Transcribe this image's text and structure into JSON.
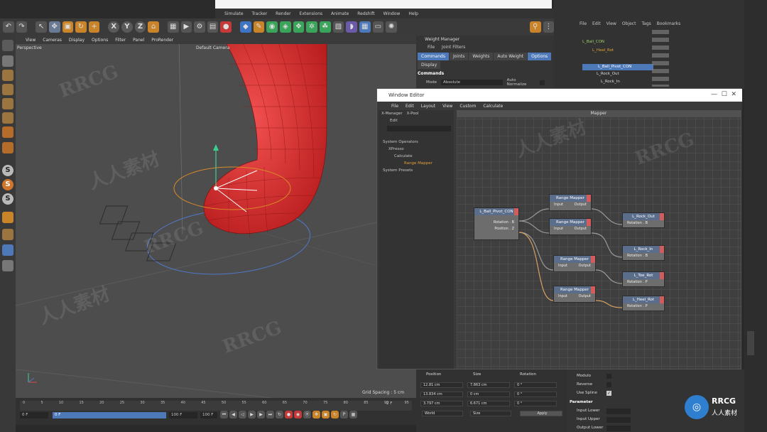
{
  "app_menu": [
    "Simulate",
    "Tracker",
    "Render",
    "Extensions",
    "Animate",
    "Redshift",
    "Window",
    "Help"
  ],
  "viewport": {
    "menu": [
      "View",
      "Cameras",
      "Display",
      "Options",
      "Filter",
      "Panel",
      "ProRender"
    ],
    "name": "Perspective",
    "camera": "Default Camera",
    "grid_spacing": "Grid Spacing : 5 cm"
  },
  "weight_manager": {
    "title": "Weight Manager",
    "menu": [
      "File",
      "Joint Filters"
    ],
    "tabs": [
      "Commands",
      "Joints",
      "Weights",
      "Auto Weight",
      "Options"
    ],
    "tab2": "Display",
    "section": "Commands",
    "mode_label": "Mode",
    "mode_value": "Absolute",
    "auto_normalize": "Auto Normalize"
  },
  "object_manager": {
    "menu": [
      "File",
      "Edit",
      "View",
      "Object",
      "Tags",
      "Bookmarks"
    ],
    "items": [
      "L_Ball_CON",
      "L_Heel_Rot",
      "L_Ball_Pivot_CON",
      "L_Rock_Out",
      "L_Rock_In"
    ]
  },
  "xpresso": {
    "title": "Window Editor",
    "menu": [
      "File",
      "Edit",
      "Layout",
      "View",
      "Custom",
      "Calculate"
    ],
    "tabs": [
      "X-Manager",
      "X-Pool"
    ],
    "field": "Edit",
    "tree": [
      "System Operators",
      "XPresso",
      "Calculate",
      "Range Mapper",
      "System Presets"
    ],
    "graph_title": "Mapper",
    "nodes": {
      "source": {
        "title": "L_Ball_Pivot_CON",
        "ports": [
          "Rotation . B",
          "Position . Z"
        ]
      },
      "rm1": {
        "title": "Range Mapper",
        "in": "Input",
        "out": "Output"
      },
      "rm2": {
        "title": "Range Mapper",
        "in": "Input",
        "out": "Output"
      },
      "rm3": {
        "title": "Range Mapper",
        "in": "Input",
        "out": "Output"
      },
      "rm4": {
        "title": "Range Mapper",
        "in": "Input",
        "out": "Output"
      },
      "t1": {
        "title": "L_Rock_Out",
        "port": "Rotation . B"
      },
      "t2": {
        "title": "L_Rock_In",
        "port": "Rotation . B"
      },
      "t3": {
        "title": "L_Toe_Rot",
        "port": "Rotation . P"
      },
      "t4": {
        "title": "L_Heel_Rot",
        "port": "Rotation . P"
      }
    }
  },
  "coordinates": {
    "headers": [
      "Position",
      "Size",
      "Rotation"
    ],
    "x": [
      "12.81 cm",
      "7.863 cm",
      "0 °"
    ],
    "y": [
      "13.834 cm",
      "0 cm",
      "0 °"
    ],
    "z": [
      "3.797 cm",
      "6.671 cm",
      "0 °"
    ],
    "mode": "World",
    "size_mode": "Size",
    "apply": "Apply"
  },
  "attributes": {
    "checks": [
      "Modulo",
      "Reverse",
      "Use Spline"
    ],
    "section": "Parameter",
    "fields": [
      "Input Lower",
      "Input Upper",
      "Output Lower"
    ]
  },
  "timeline": {
    "ticks": [
      "0",
      "5",
      "10",
      "15",
      "20",
      "25",
      "30",
      "35",
      "40",
      "45",
      "50",
      "55",
      "60",
      "65",
      "70",
      "75",
      "80",
      "85",
      "90",
      "95"
    ],
    "frame_start": "0 F",
    "frame_current": "0 F",
    "frame_end": "100 F",
    "frame_total": "100 F",
    "frame_right": "-2 F"
  },
  "brand": {
    "name": "RRCG",
    "sub": "人人素材"
  },
  "watermarks": [
    "RRCG",
    "人人素材"
  ]
}
